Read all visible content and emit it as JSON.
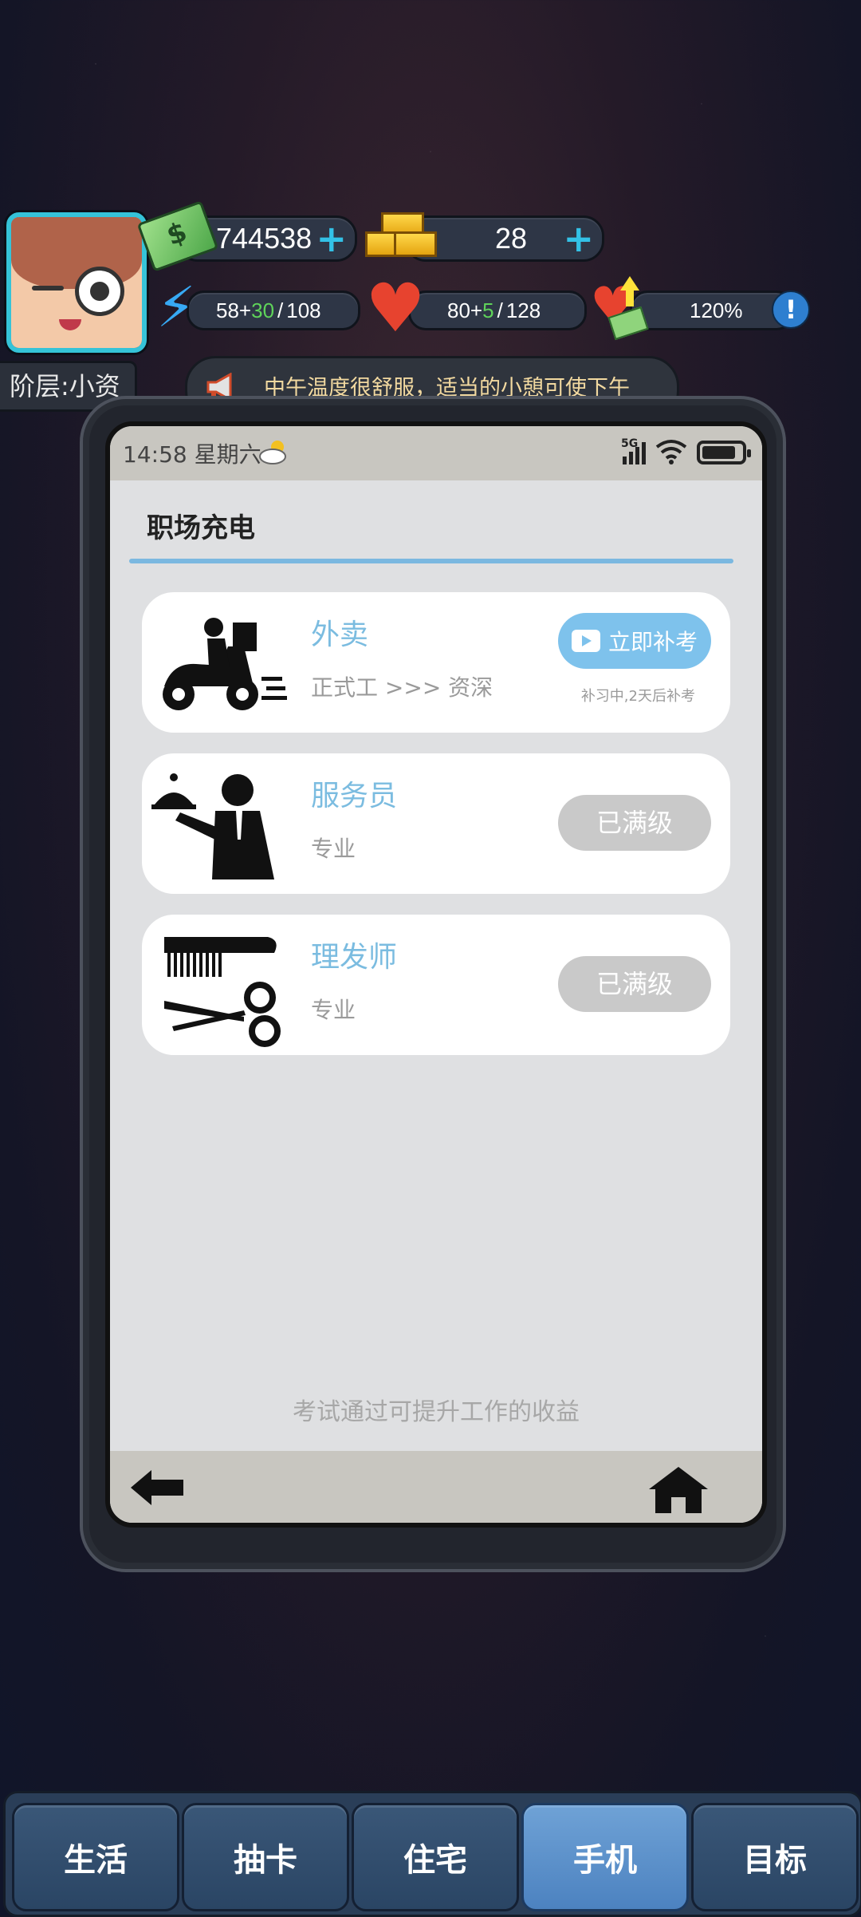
{
  "hud": {
    "cash": "744538",
    "gold": "28",
    "energy": {
      "base": "58",
      "bonus": "30",
      "max": "108",
      "plus": "+",
      "sep": "/"
    },
    "health": {
      "base": "80",
      "bonus": "5",
      "max": "128",
      "plus": "+",
      "sep": "/"
    },
    "mood": "120%",
    "info_label": "!",
    "plus_label": "+",
    "tier": "阶层:小资",
    "news": "中午温度很舒服，适当的小憩可使下午"
  },
  "phone": {
    "time": "14:58 星期六",
    "network": "5G",
    "page_title": "职场充电",
    "jobs": [
      {
        "name": "外卖",
        "detail": "正式工 >>> 资深",
        "action": "立即补考",
        "note": "补习中,2天后补考",
        "icon": "scooter-icon"
      },
      {
        "name": "服务员",
        "detail": "专业",
        "action": "已满级",
        "icon": "waiter-icon"
      },
      {
        "name": "理发师",
        "detail": "专业",
        "action": "已满级",
        "icon": "comb-scissors-icon"
      }
    ],
    "footer_text": "考试通过可提升工作的收益"
  },
  "tabs": [
    {
      "label": "生活",
      "active": false
    },
    {
      "label": "抽卡",
      "active": false
    },
    {
      "label": "住宅",
      "active": false
    },
    {
      "label": "手机",
      "active": true
    },
    {
      "label": "目标",
      "active": false
    }
  ],
  "colors": {
    "accent": "#7ec2ec",
    "tab_active": "#5b8fc8",
    "tab_inactive": "#2f4a68",
    "disabled": "#c9c9c9"
  }
}
